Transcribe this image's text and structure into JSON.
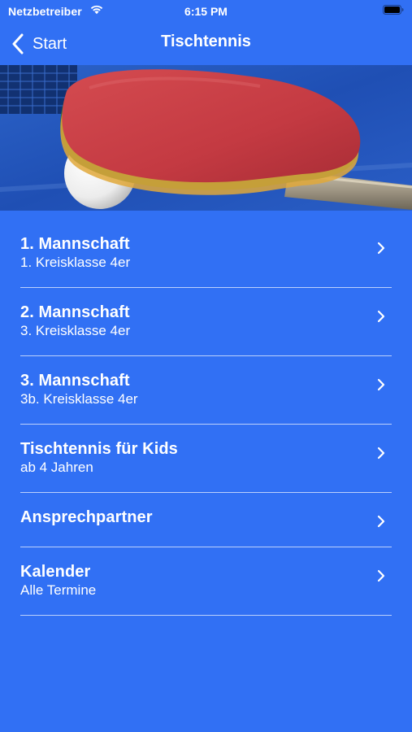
{
  "status_bar": {
    "carrier": "Netzbetreiber",
    "time": "6:15 PM"
  },
  "nav": {
    "back_label": "Start",
    "title": "Tischtennis"
  },
  "colors": {
    "background": "#3170f4",
    "text": "#ffffff",
    "divider": "#ebf0ff"
  },
  "hero": {
    "icon": "table-tennis-paddle-and-ball-photo"
  },
  "list": {
    "items": [
      {
        "title": "1. Mannschaft",
        "subtitle": "1. Kreisklasse 4er"
      },
      {
        "title": "2. Mannschaft",
        "subtitle": "3. Kreisklasse 4er"
      },
      {
        "title": "3. Mannschaft",
        "subtitle": "3b. Kreisklasse 4er"
      },
      {
        "title": "Tischtennis für Kids",
        "subtitle": "ab 4 Jahren"
      },
      {
        "title": "Ansprechpartner"
      },
      {
        "title": "Kalender",
        "subtitle": "Alle Termine"
      }
    ]
  }
}
